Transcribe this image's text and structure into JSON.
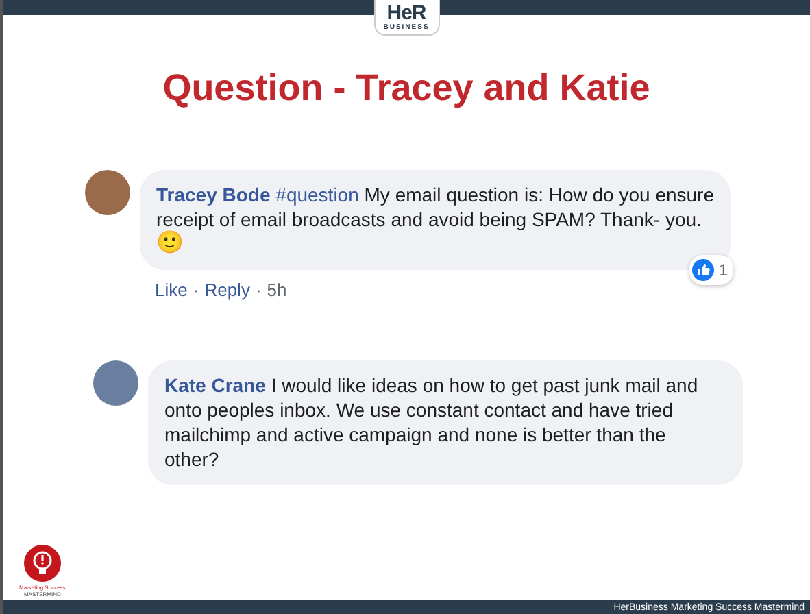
{
  "header": {
    "logo_main": "HeR",
    "logo_sub": "BUSINESS"
  },
  "title": "Question - Tracey and Katie",
  "comments": [
    {
      "author": "Tracey Bode",
      "hashtag": "#question",
      "text": "My email question is: How do you ensure receipt of email broadcasts and avoid being SPAM? Thank- you.",
      "emoji": "🙂",
      "actions": [
        "Like",
        "Reply",
        "5h"
      ],
      "separator": "·",
      "likes": "1"
    },
    {
      "author": "Kate Crane",
      "text": "I would like ideas on how to get past junk mail and onto peoples inbox. We use constant contact and have tried mailchimp and active campaign and none is better than the other?"
    }
  ],
  "footer_logo": {
    "line_1": "Marketing Success",
    "line_2": "MASTERMIND"
  },
  "footer": "HerBusiness Marketing Success Mastermind"
}
